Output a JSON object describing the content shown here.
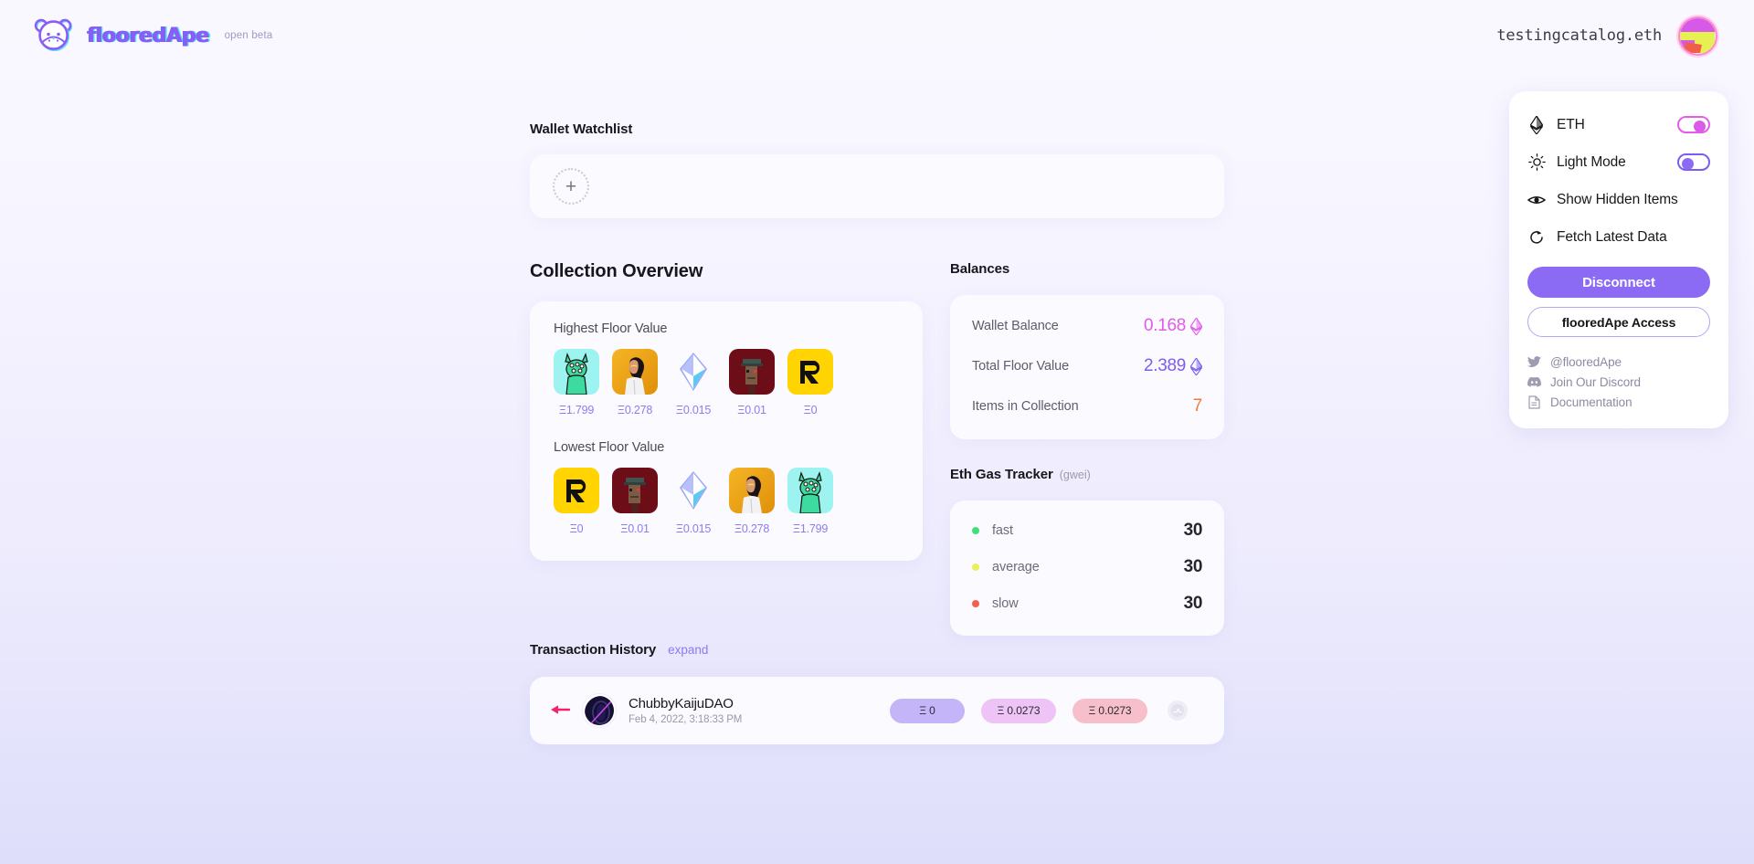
{
  "header": {
    "brand_name": "flooredApe",
    "brand_beta": "open beta",
    "brand_logo_icon": "ape-logo-icon",
    "account_name": "testingcatalog.eth",
    "avatar_icon": "user-avatar"
  },
  "settings": {
    "rows": [
      {
        "icon": "ethereum-icon",
        "label": "ETH",
        "control": "toggle",
        "state": "on"
      },
      {
        "icon": "sun-icon",
        "label": "Light Mode",
        "control": "toggle",
        "state": "off"
      },
      {
        "icon": "eye-icon",
        "label": "Show Hidden Items",
        "control": "none"
      },
      {
        "icon": "refresh-icon",
        "label": "Fetch Latest Data",
        "control": "none"
      }
    ],
    "disconnect_label": "Disconnect",
    "access_label": "flooredApe Access",
    "links": [
      {
        "icon": "twitter-icon",
        "label": "@flooredApe"
      },
      {
        "icon": "discord-icon",
        "label": "Join Our Discord"
      },
      {
        "icon": "document-icon",
        "label": "Documentation"
      }
    ],
    "colors": {
      "toggle_on": "#d95ce8",
      "toggle_off": "#8b6bf3",
      "primary": "#8b6bf3"
    }
  },
  "watchlist": {
    "title": "Wallet Watchlist",
    "add_icon": "plus-icon",
    "add_label": "+"
  },
  "collection": {
    "title": "Collection Overview",
    "highest": {
      "label": "Highest Floor Value",
      "items": [
        {
          "art": "kaiju-green",
          "price": "Ξ1.799"
        },
        {
          "art": "gold-portrait",
          "price": "Ξ0.278"
        },
        {
          "art": "ens-diamond",
          "price": "Ξ0.015"
        },
        {
          "art": "pixel-red",
          "price": "Ξ0.01"
        },
        {
          "art": "yellow-r",
          "price": "Ξ0"
        }
      ]
    },
    "lowest": {
      "label": "Lowest Floor Value",
      "items": [
        {
          "art": "yellow-r",
          "price": "Ξ0"
        },
        {
          "art": "pixel-red",
          "price": "Ξ0.01"
        },
        {
          "art": "ens-diamond",
          "price": "Ξ0.015"
        },
        {
          "art": "gold-portrait",
          "price": "Ξ0.278"
        },
        {
          "art": "kaiju-green",
          "price": "Ξ1.799"
        }
      ]
    }
  },
  "balances": {
    "title": "Balances",
    "rows": [
      {
        "label": "Wallet Balance",
        "value": "0.168",
        "unit_icon": "ethereum-icon",
        "color": "#e05ce8"
      },
      {
        "label": "Total Floor Value",
        "value": "2.389",
        "unit_icon": "ethereum-icon",
        "color": "#7c5cf0"
      },
      {
        "label": "Items in Collection",
        "value": "7",
        "unit_icon": "",
        "color": "#f07c40"
      }
    ]
  },
  "gas": {
    "title": "Eth Gas Tracker",
    "unit": "(gwei)",
    "rows": [
      {
        "name": "fast",
        "value": "30",
        "color": "#3fe07a"
      },
      {
        "name": "average",
        "value": "30",
        "color": "#e9f05a"
      },
      {
        "name": "slow",
        "value": "30",
        "color": "#f4604f"
      }
    ]
  },
  "transactions": {
    "title": "Transaction History",
    "expand_label": "expand",
    "rows": [
      {
        "direction_icon": "arrow-left-icon",
        "avatar": "chubbykaiju-avatar",
        "name": "ChubbyKaijuDAO",
        "date": "Feb 4, 2022, 3:18:33 PM",
        "badges": [
          {
            "label": "Ξ 0",
            "color": "#c3b5f7"
          },
          {
            "label": "Ξ 0.0273",
            "color": "#eec4f7"
          },
          {
            "label": "Ξ 0.0273",
            "color": "#f7bfc9"
          }
        ],
        "link_icon": "opensea-icon"
      }
    ]
  }
}
